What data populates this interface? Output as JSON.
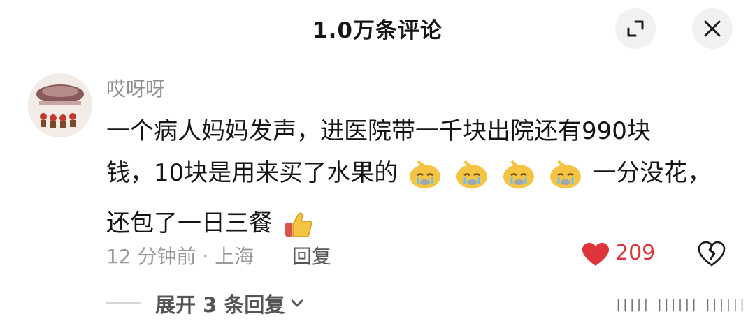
{
  "header": {
    "title": "1.0万条评论",
    "expand_icon": "shrink-icon",
    "close_icon": "close-icon"
  },
  "comment": {
    "username": "哎呀呀",
    "avatar_icon": "user-avatar",
    "text_line1": "一个病人妈妈发声，进医院带一千块出院还有990块",
    "text_line2a": "钱，10块是用来买了水果的",
    "text_line2b": "一分没花，",
    "text_line3": "还包了一日三餐",
    "emoji_sad": "crying-face-emoji",
    "emoji_thumb": "thumbs-up-emoji",
    "meta": "12 分钟前 · 上海",
    "reply_label": "回复",
    "like_count": "209",
    "expand_replies": "展开 3 条回复"
  },
  "colors": {
    "like": "#e0343d",
    "muted": "#8f8f8f"
  }
}
